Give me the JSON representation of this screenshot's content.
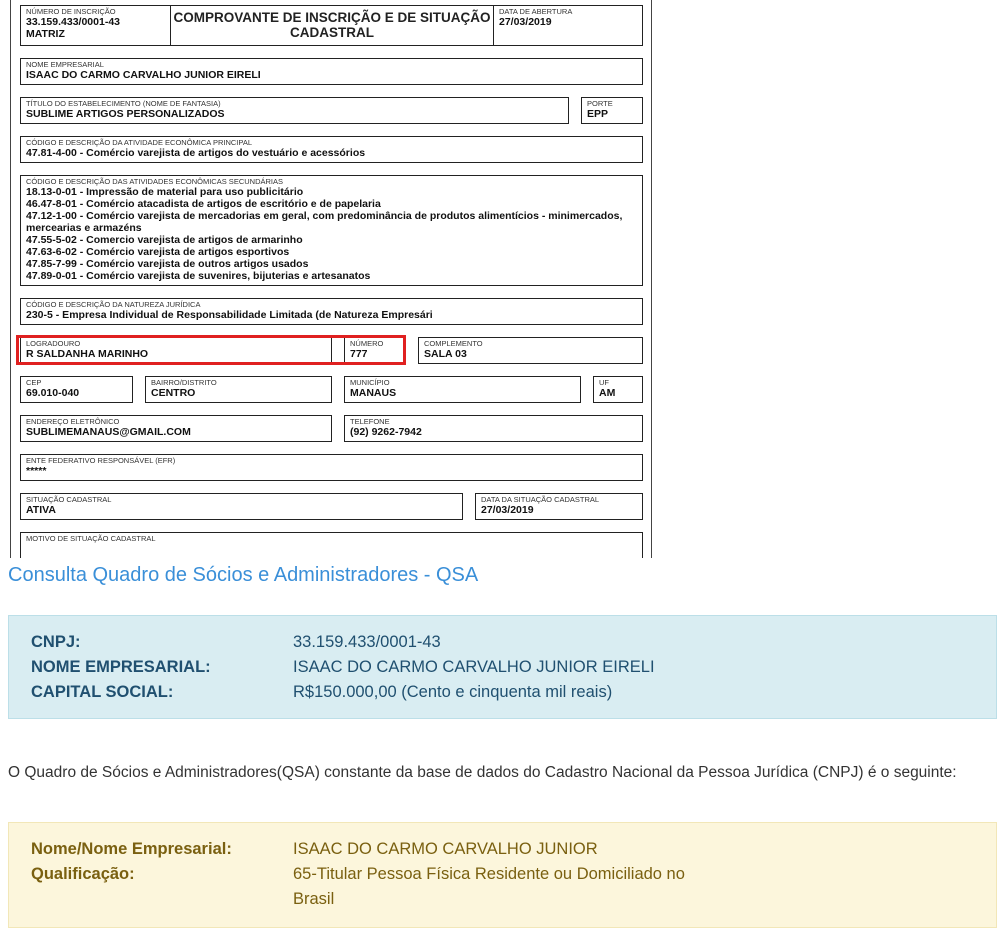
{
  "certificate": {
    "title": "COMPROVANTE DE INSCRIÇÃO E DE SITUAÇÃO CADASTRAL",
    "inscricao": {
      "label": "NÚMERO DE INSCRIÇÃO",
      "value": "33.159.433/0001-43",
      "type": "MATRIZ"
    },
    "abertura": {
      "label": "DATA DE ABERTURA",
      "value": "27/03/2019"
    },
    "nome_empresarial": {
      "label": "NOME EMPRESARIAL",
      "value": "ISAAC DO CARMO CARVALHO JUNIOR EIRELI"
    },
    "fantasia": {
      "label": "TÍTULO DO ESTABELECIMENTO (NOME DE FANTASIA)",
      "value": "SUBLIME ARTIGOS PERSONALIZADOS"
    },
    "porte": {
      "label": "PORTE",
      "value": "EPP"
    },
    "atividade_principal": {
      "label": "CÓDIGO E DESCRIÇÃO DA ATIVIDADE ECONÔMICA PRINCIPAL",
      "value": "47.81-4-00 - Comércio varejista de artigos do vestuário e acessórios"
    },
    "atividades_secundarias": {
      "label": "CÓDIGO E DESCRIÇÃO DAS ATIVIDADES ECONÔMICAS SECUNDÁRIAS",
      "items": [
        "18.13-0-01 - Impressão de material para uso publicitário",
        "46.47-8-01 - Comércio atacadista de artigos de escritório e de papelaria",
        "47.12-1-00 - Comércio varejista de mercadorias em geral, com predominância de produtos alimentícios - minimercados, mercearias e armazéns",
        "47.55-5-02 - Comercio varejista de artigos de armarinho",
        "47.63-6-02 - Comércio varejista de artigos esportivos",
        "47.85-7-99 - Comércio varejista de outros artigos usados",
        "47.89-0-01 - Comércio varejista de suvenires, bijuterias e artesanatos"
      ]
    },
    "natureza_juridica": {
      "label": "CÓDIGO E DESCRIÇÃO DA NATUREZA JURÍDICA",
      "value": "230-5 - Empresa Individual de Responsabilidade Limitada (de Natureza Empresári"
    },
    "logradouro": {
      "label": "LOGRADOURO",
      "value": "R SALDANHA MARINHO"
    },
    "numero": {
      "label": "NÚMERO",
      "value": "777"
    },
    "complemento": {
      "label": "COMPLEMENTO",
      "value": "SALA 03"
    },
    "cep": {
      "label": "CEP",
      "value": "69.010-040"
    },
    "bairro": {
      "label": "BAIRRO/DISTRITO",
      "value": "CENTRO"
    },
    "municipio": {
      "label": "MUNICÍPIO",
      "value": "MANAUS"
    },
    "uf": {
      "label": "UF",
      "value": "AM"
    },
    "email": {
      "label": "ENDEREÇO ELETRÔNICO",
      "value": "SUBLIMEMANAUS@GMAIL.COM"
    },
    "telefone": {
      "label": "TELEFONE",
      "value": "(92) 9262-7942"
    },
    "efr": {
      "label": "ENTE FEDERATIVO RESPONSÁVEL (EFR)",
      "value": "*****"
    },
    "situacao": {
      "label": "SITUAÇÃO CADASTRAL",
      "value": "ATIVA"
    },
    "data_situacao": {
      "label": "DATA DA SITUAÇÃO CADASTRAL",
      "value": "27/03/2019"
    },
    "motivo": {
      "label": "MOTIVO DE SITUAÇÃO CADASTRAL",
      "value": ""
    }
  },
  "qsa": {
    "heading": "Consulta Quadro de Sócios e Administradores - QSA",
    "summary": [
      {
        "key": "CNPJ:",
        "value": "33.159.433/0001-43"
      },
      {
        "key": "NOME EMPRESARIAL:",
        "value": "ISAAC DO CARMO CARVALHO JUNIOR EIRELI"
      },
      {
        "key": "CAPITAL SOCIAL:",
        "value": "R$150.000,00 (Cento e cinquenta mil reais)"
      }
    ],
    "intro": "O Quadro de Sócios e Administradores(QSA) constante da base de dados do Cadastro Nacional da Pessoa Jurídica (CNPJ) é o seguinte:",
    "partner": {
      "name_key": "Nome/Nome Empresarial:",
      "name_value": "ISAAC DO CARMO CARVALHO JUNIOR",
      "qual_key": "Qualificação:",
      "qual_value_line1": "65-Titular Pessoa Física Residente ou Domiciliado no",
      "qual_value_line2": "Brasil"
    }
  },
  "colors": {
    "highlight": "#e02020",
    "heading": "#3a8fd8",
    "info_bg": "#d9edf2",
    "partner_bg": "#fcf6dc"
  }
}
